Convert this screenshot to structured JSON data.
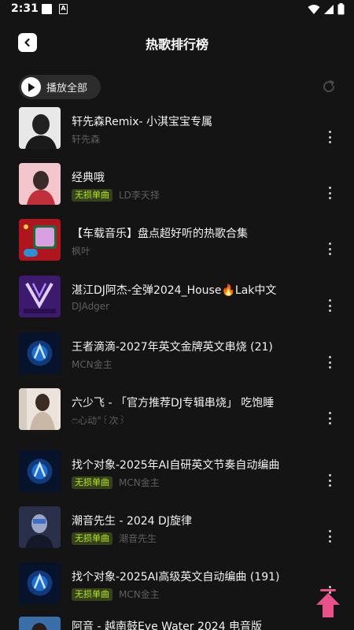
{
  "status": {
    "time": "2:31"
  },
  "header": {
    "title": "热歌排行榜"
  },
  "controls": {
    "play_all_label": "播放全部"
  },
  "songs": [
    {
      "title": "轩先森Remix- 小淇宝宝专属",
      "artist": "轩先森",
      "badge": ""
    },
    {
      "title": "经典哦",
      "artist": "LD李天择",
      "badge": "无损单曲"
    },
    {
      "title": "【车载音乐】盘点超好听的热歌合集",
      "artist": "枫叶",
      "badge": ""
    },
    {
      "title": "湛江DJ阿杰-全弹2024_House🔥Lak中文",
      "artist": "DJAdger",
      "badge": ""
    },
    {
      "title": "王者滴滴-2027年英文金牌英文串烧 (21)",
      "artist": "MCN金主",
      "badge": ""
    },
    {
      "title": "六少飞 - 「官方推荐DJ专辑串烧」 吃饱睡",
      "artist": "ෆ心动°꒰次꒱",
      "badge": ""
    },
    {
      "title": "找个对象-2025年AI自研英文节奏自动编曲",
      "artist": "MCN金主",
      "badge": "无损单曲"
    },
    {
      "title": "潮音先生 - 2024 DJ旋律",
      "artist": "潮音先生",
      "badge": "无损单曲"
    },
    {
      "title": "找个对象-2025AI高级英文自动编曲 (191)",
      "artist": "MCN金主",
      "badge": "无损单曲"
    },
    {
      "title": "阿音 - 越南鼓Eye Water 2024 电音版",
      "artist": "",
      "badge": ""
    }
  ],
  "colors": {
    "background": "#141414",
    "badge_text": "#b5e61d",
    "badge_bg": "#35411a",
    "accent_pink": "#e9518a"
  }
}
